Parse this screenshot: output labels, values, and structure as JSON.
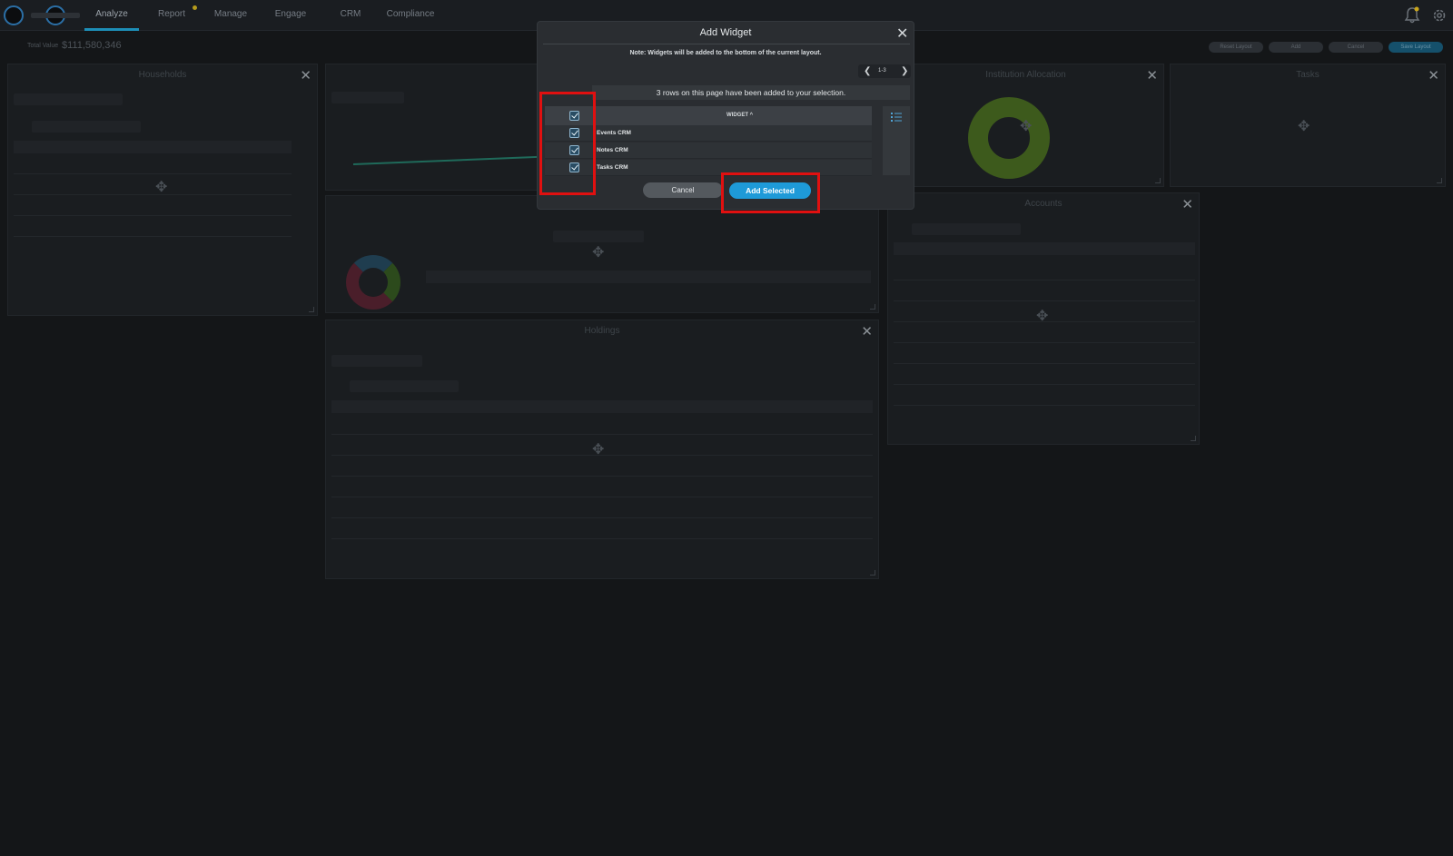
{
  "nav": {
    "items": [
      "Analyze",
      "Report",
      "Manage",
      "Engage",
      "CRM",
      "Compliance"
    ]
  },
  "toolbar": {
    "label": "Total Value",
    "value": "$111,580,346",
    "buttons": [
      "Reset Layout",
      "Add",
      "Cancel",
      "Save Layout"
    ]
  },
  "panels": {
    "households": "Households",
    "allocation": "Institution Allocation",
    "tasks": "Tasks",
    "accounts": "Accounts",
    "holdings": "Holdings"
  },
  "modal": {
    "title": "Add Widget",
    "note": "Note: Widgets will be added to the bottom of the current layout.",
    "pager_range": "1-3",
    "selection_message": "3 rows on this page have been added to your selection.",
    "column_header": "WIDGET ^",
    "rows": [
      "Events CRM",
      "Notes CRM",
      "Tasks CRM"
    ],
    "cancel_label": "Cancel",
    "add_label": "Add Selected"
  },
  "colors": {
    "accent": "#1e9ad8",
    "highlight": "#e01010"
  }
}
